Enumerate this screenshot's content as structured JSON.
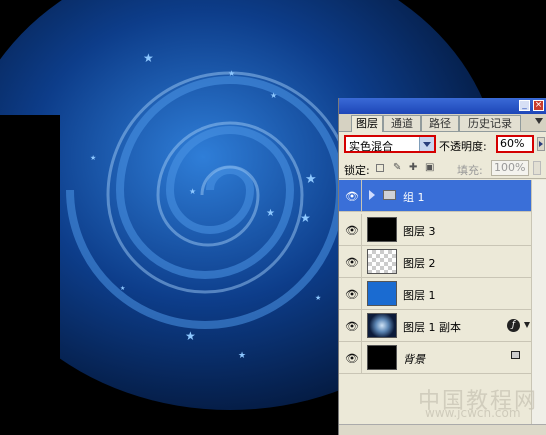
{
  "panel": {
    "tabs": [
      {
        "label": "图层",
        "active": true
      },
      {
        "label": "通道",
        "active": false
      },
      {
        "label": "路径",
        "active": false
      },
      {
        "label": "历史记录",
        "active": false
      }
    ],
    "blend_mode": "实色混合",
    "opacity_label": "不透明度:",
    "opacity_value": "60%",
    "lock_label": "锁定:",
    "fill_label": "填充:",
    "fill_value": "100%",
    "layers": [
      {
        "name": "组 1",
        "type": "group",
        "selected": true
      },
      {
        "name": "图层 3",
        "type": "layer",
        "thumb": "black"
      },
      {
        "name": "图层 2",
        "type": "layer",
        "thumb": "transparent"
      },
      {
        "name": "图层 1",
        "type": "layer",
        "thumb": "blue"
      },
      {
        "name": "图层 1 副本",
        "type": "layer",
        "thumb": "swirl",
        "fx": true
      },
      {
        "name": "背景",
        "type": "background",
        "thumb": "black",
        "locked": true
      }
    ]
  },
  "watermark": {
    "title": "中国教程网",
    "url": "www.jcwcn.com"
  },
  "colors": {
    "accent": "#3a6fd8",
    "highlight_border": "#d40000",
    "swirl": "#2a6fc0"
  }
}
